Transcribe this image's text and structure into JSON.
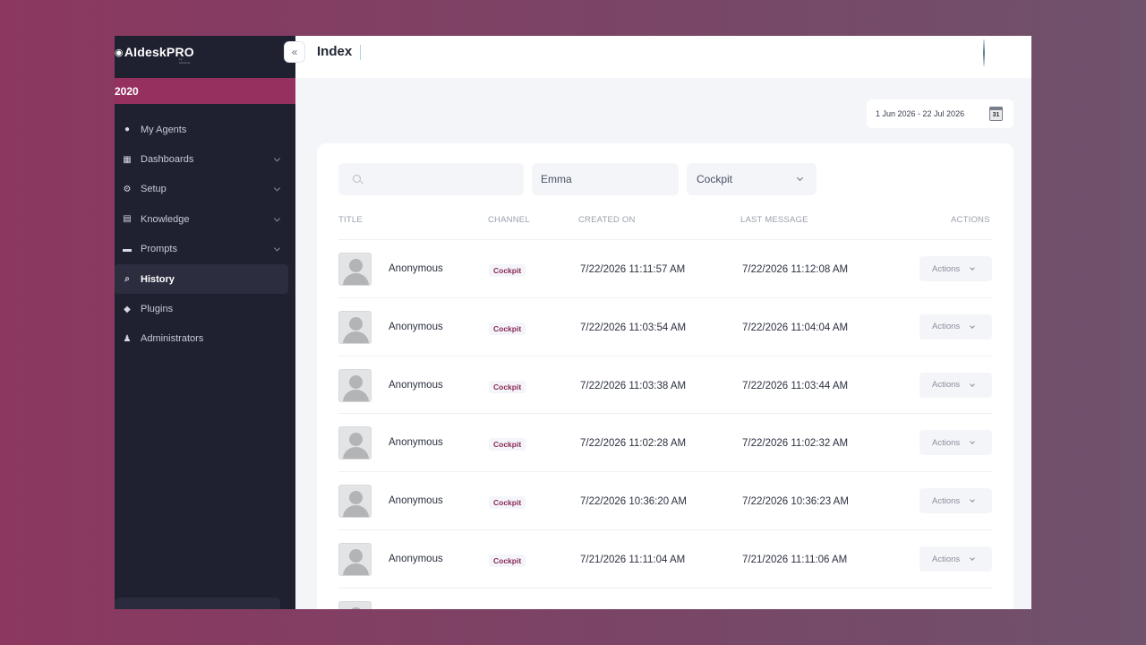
{
  "app": {
    "logo": "AIdeskPRO",
    "logo_sub": "by altostrat",
    "org": "2020"
  },
  "sidebar": {
    "items": [
      {
        "label": "My Agents",
        "icon": "agents-icon",
        "glyph": "●",
        "expandable": false,
        "active": false
      },
      {
        "label": "Dashboards",
        "icon": "dashboard-icon",
        "glyph": "▦",
        "expandable": true,
        "active": false
      },
      {
        "label": "Setup",
        "icon": "gear-icon",
        "glyph": "⚙",
        "expandable": true,
        "active": false
      },
      {
        "label": "Knowledge",
        "icon": "document-icon",
        "glyph": "▤",
        "expandable": true,
        "active": false
      },
      {
        "label": "Prompts",
        "icon": "prompt-icon",
        "glyph": "▬",
        "expandable": true,
        "active": false
      },
      {
        "label": "History",
        "icon": "search-history-icon",
        "glyph": "⌕",
        "expandable": false,
        "active": true
      },
      {
        "label": "Plugins",
        "icon": "plugin-icon",
        "glyph": "◆",
        "expandable": false,
        "active": false
      },
      {
        "label": "Administrators",
        "icon": "user-icon",
        "glyph": "♟",
        "expandable": false,
        "active": false
      }
    ]
  },
  "header": {
    "title": "Index"
  },
  "filters": {
    "date_range": "1 Jun 2026 - 22 Jul 2026",
    "calendar_day": "31",
    "search_placeholder": "",
    "name_value": "Emma",
    "channel_value": "Cockpit"
  },
  "table": {
    "columns": [
      "TITLE",
      "CHANNEL",
      "CREATED ON",
      "LAST MESSAGE",
      "ACTIONS"
    ],
    "rows": [
      {
        "title": "Anonymous",
        "channel": "Cockpit",
        "created": "7/22/2026 11:11:57 AM",
        "last": "7/22/2026 11:12:08 AM",
        "action": "Actions"
      },
      {
        "title": "Anonymous",
        "channel": "Cockpit",
        "created": "7/22/2026 11:03:54 AM",
        "last": "7/22/2026 11:04:04 AM",
        "action": "Actions"
      },
      {
        "title": "Anonymous",
        "channel": "Cockpit",
        "created": "7/22/2026 11:03:38 AM",
        "last": "7/22/2026 11:03:44 AM",
        "action": "Actions"
      },
      {
        "title": "Anonymous",
        "channel": "Cockpit",
        "created": "7/22/2026 11:02:28 AM",
        "last": "7/22/2026 11:02:32 AM",
        "action": "Actions"
      },
      {
        "title": "Anonymous",
        "channel": "Cockpit",
        "created": "7/22/2026 10:36:20 AM",
        "last": "7/22/2026 10:36:23 AM",
        "action": "Actions"
      },
      {
        "title": "Anonymous",
        "channel": "Cockpit",
        "created": "7/21/2026 11:11:04 AM",
        "last": "7/21/2026 11:11:06 AM",
        "action": "Actions"
      }
    ]
  },
  "colors": {
    "brand": "#96305f",
    "sidebar": "#1f2030",
    "background": "#f3f5f8"
  }
}
